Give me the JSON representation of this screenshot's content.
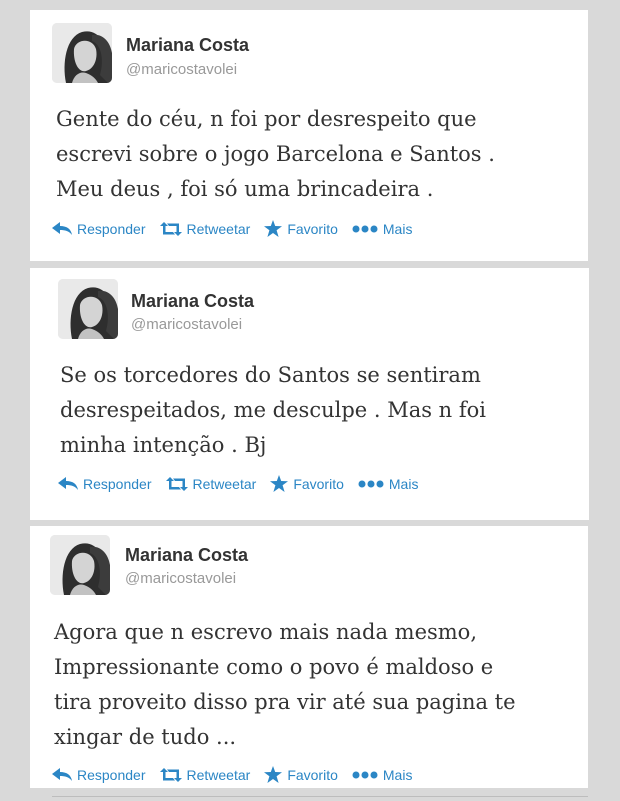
{
  "tweets": [
    {
      "name": "Mariana Costa",
      "handle": "@maricostavolei",
      "lines": [
        "Gente do céu, n foi por desrespeito que",
        "escrevi sobre o jogo Barcelona e Santos .",
        "Meu deus , foi só uma brincadeira ."
      ]
    },
    {
      "name": "Mariana Costa",
      "handle": "@maricostavolei",
      "lines": [
        "Se os torcedores do Santos se sentiram",
        "desrespeitados, me desculpe . Mas n foi",
        "minha intenção . Bj"
      ]
    },
    {
      "name": "Mariana Costa",
      "handle": "@maricostavolei",
      "lines": [
        "Agora que n escrevo mais nada mesmo,",
        "Impressionante como o povo é maldoso e",
        "tira proveito disso pra vir até sua pagina te",
        "xingar de tudo ..."
      ]
    }
  ],
  "actions": {
    "reply": "Responder",
    "retweet": "Retweetar",
    "favorite": "Favorito",
    "more": "Mais"
  },
  "icons": {
    "reply": "reply-arrow-icon",
    "retweet": "retweet-icon",
    "favorite": "star-icon",
    "more": "more-dots-icon"
  },
  "colors": {
    "background": "#d9d9d9",
    "card": "#ffffff",
    "name": "#333333",
    "handle": "#999999",
    "text": "#333333",
    "link": "#2b86c5"
  }
}
